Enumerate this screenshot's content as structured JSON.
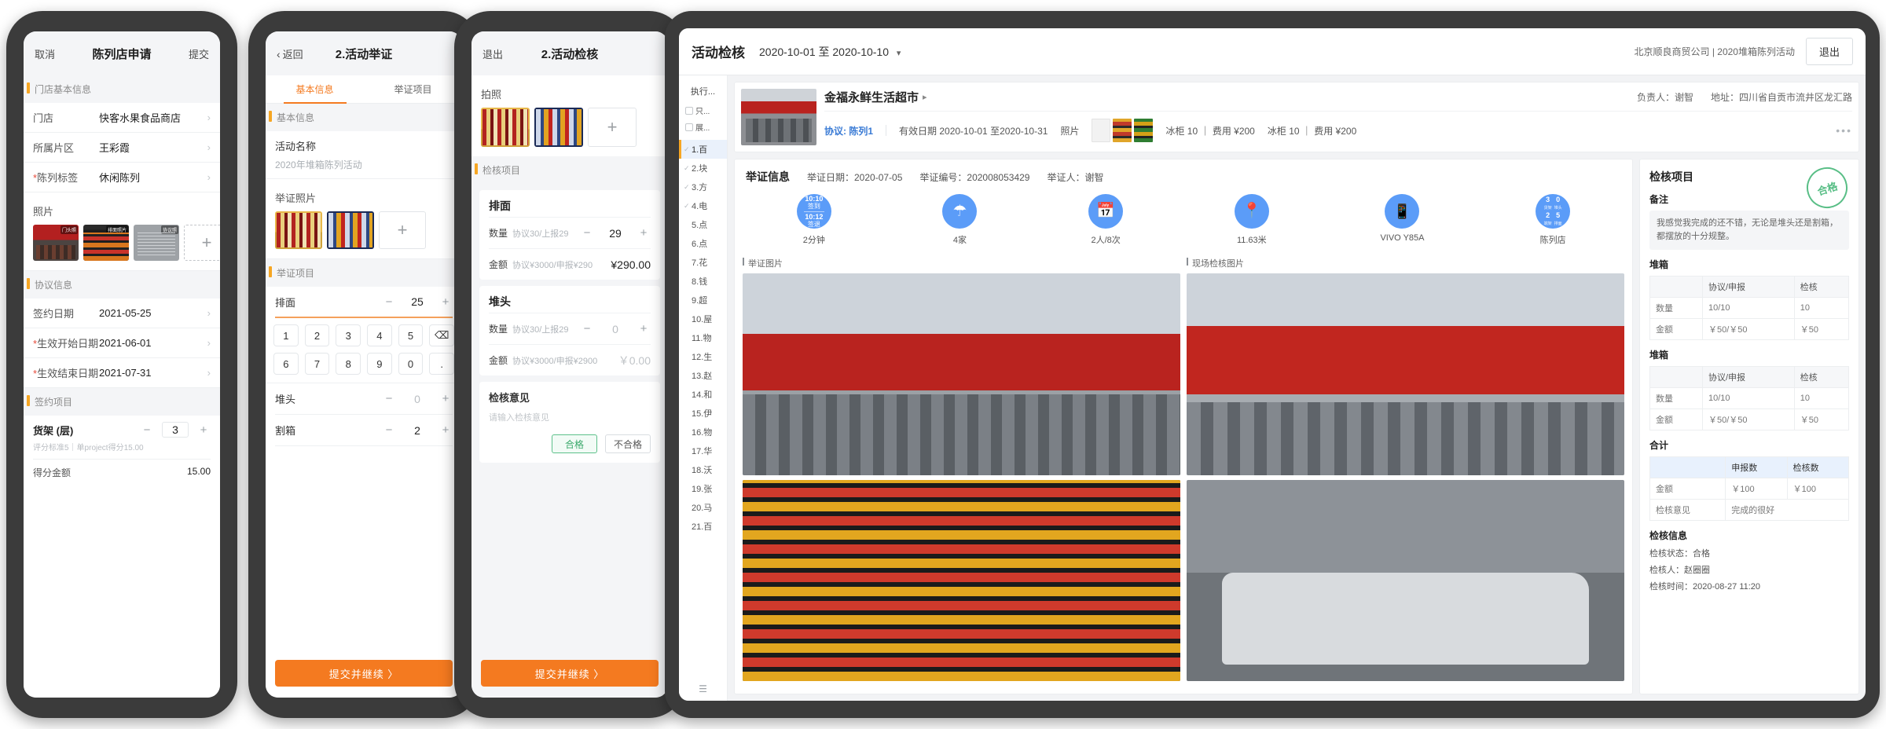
{
  "phone1": {
    "nav": {
      "left": "取消",
      "title": "陈列店申请",
      "right": "提交"
    },
    "sections": [
      {
        "title": "门店基本信息"
      }
    ],
    "store_rows": [
      {
        "label": "门店",
        "value": "快客水果食品商店",
        "required": false
      },
      {
        "label": "所属片区",
        "value": "王彩霞",
        "required": false
      },
      {
        "label": "陈列标签",
        "value": "休闲陈列",
        "required": true
      }
    ],
    "photos_label": "照片",
    "photo_captions": [
      "门头照",
      "排面照片",
      "协议照"
    ],
    "agreement_title": "协议信息",
    "agreement_rows": [
      {
        "label": "签约日期",
        "value": "2021-05-25",
        "required": false
      },
      {
        "label": "生效开始日期",
        "value": "2021-06-01",
        "required": true
      },
      {
        "label": "生效结束日期",
        "value": "2021-07-31",
        "required": true
      }
    ],
    "signed_title": "签约项目",
    "signed_item": {
      "name": "货架 (层)",
      "rule": "评分标准5｜单project得分15.00",
      "qty": "3",
      "amount_label": "得分金额",
      "amount_value": "15.00"
    }
  },
  "phone2": {
    "nav": {
      "left": "返回",
      "title": "2.活动举证"
    },
    "tabs": [
      {
        "label": "基本信息",
        "active": true
      },
      {
        "label": "举证项目",
        "active": false
      }
    ],
    "section_basic": "基本信息",
    "activity_label": "活动名称",
    "activity_value": "2020年堆箱陈列活动",
    "photos_label": "举证照片",
    "section_items": "举证项目",
    "item_rows": [
      {
        "name": "排面",
        "value": "25",
        "dim": false
      },
      {
        "name": "堆头",
        "value": "0",
        "dim": true
      },
      {
        "name": "割箱",
        "value": "2",
        "dim": false
      }
    ],
    "keypad": [
      [
        "1",
        "2",
        "3",
        "4",
        "5",
        "⌫"
      ],
      [
        "6",
        "7",
        "8",
        "9",
        "0",
        "."
      ]
    ],
    "submit": "提交并继续 〉"
  },
  "phone3": {
    "nav": {
      "left": "退出",
      "title": "2.活动检核"
    },
    "photo_label": "拍照",
    "section_items": "检核项目",
    "cards": [
      {
        "title": "排面",
        "qty_label": "数量",
        "qty_sub": "协议30/上报29",
        "qty_value": "29",
        "qty_dim": false,
        "amt_label": "金额",
        "amt_sub": "协议¥3000/申报¥290",
        "amt_value": "¥290.00",
        "amt_dim": false
      },
      {
        "title": "堆头",
        "qty_label": "数量",
        "qty_sub": "协议30/上报29",
        "qty_value": "0",
        "qty_dim": true,
        "amt_label": "金额",
        "amt_sub": "协议¥3000/申报¥2900",
        "amt_value": "￥0.00",
        "amt_dim": true
      }
    ],
    "opinion": {
      "title": "检核意见",
      "placeholder": "请输入检核意见",
      "pass": "合格",
      "fail": "不合格"
    },
    "submit": "提交并继续 〉"
  },
  "tablet": {
    "header": {
      "title": "活动检核",
      "date_range": "2020-10-01 至 2020-10-10",
      "company": "北京顺良商贸公司",
      "activity": "2020堆箱陈列活动",
      "logout": "退出"
    },
    "sidebar": {
      "filter_title": "执行...",
      "checks": [
        "只...",
        "展..."
      ],
      "items": [
        {
          "n": "1.百",
          "done": true,
          "active": true
        },
        {
          "n": "2.块",
          "done": true,
          "active": false
        },
        {
          "n": "3.方",
          "done": true,
          "active": false
        },
        {
          "n": "4.电",
          "done": true,
          "active": false
        },
        {
          "n": "5.点",
          "done": false,
          "active": false
        },
        {
          "n": "6.点",
          "done": false,
          "active": false
        },
        {
          "n": "7.花",
          "done": false,
          "active": false
        },
        {
          "n": "8.钱",
          "done": false,
          "active": false
        },
        {
          "n": "9.超",
          "done": false,
          "active": false
        },
        {
          "n": "10.屋",
          "done": false,
          "active": false
        },
        {
          "n": "11.物",
          "done": false,
          "active": false
        },
        {
          "n": "12.生",
          "done": false,
          "active": false
        },
        {
          "n": "13.赵",
          "done": false,
          "active": false
        },
        {
          "n": "14.和",
          "done": false,
          "active": false
        },
        {
          "n": "15.伊",
          "done": false,
          "active": false
        },
        {
          "n": "16.物",
          "done": false,
          "active": false
        },
        {
          "n": "17.华",
          "done": false,
          "active": false
        },
        {
          "n": "18.沃",
          "done": false,
          "active": false
        },
        {
          "n": "19.张",
          "done": false,
          "active": false
        },
        {
          "n": "20.马",
          "done": false,
          "active": false
        },
        {
          "n": "21.百",
          "done": false,
          "active": false
        }
      ]
    },
    "store": {
      "name": "金福永鲜生活超市",
      "owner": "负责人：谢智",
      "address": "地址：四川省自贡市流井区龙汇路",
      "agreement": "协议: 陈列1",
      "valid": "有效日期 2020-10-01 至2020-10-31",
      "photo_label": "照片",
      "stat1": "冰柜 10 ｜ 费用 ¥200",
      "stat2": "冰柜 10 ｜ 费用 ¥200"
    },
    "evidence": {
      "title": "举证信息",
      "date": "举证日期：2020-07-05",
      "number": "举证编号：202008053429",
      "person": "举证人：谢智",
      "stats": [
        {
          "icon": "clock-icon",
          "top": "10:10",
          "top_sub": "签到",
          "bottom": "10:12",
          "bottom_sub": "签退",
          "caption": "2分钟"
        },
        {
          "icon": "globe-icon",
          "caption": "4家"
        },
        {
          "icon": "calendar-icon",
          "caption": "2人/8次"
        },
        {
          "icon": "location-icon",
          "caption": "11.63米"
        },
        {
          "icon": "phone-icon",
          "caption": "VIVO Y85A"
        },
        {
          "icon": "grid-icon",
          "caption": "陈列店",
          "q": [
            {
              "v": "3",
              "l": "货架"
            },
            {
              "v": "0",
              "l": "堆头"
            },
            {
              "v": "2",
              "l": "端架"
            },
            {
              "v": "5",
              "l": "排面"
            }
          ]
        }
      ],
      "col_titles": [
        "举证图片",
        "现场检核图片"
      ]
    },
    "review": {
      "title": "检核项目",
      "stamp": "合格",
      "note_title": "备注",
      "note": "我感觉我完成的还不错，无论是堆头还是割箱，都摆放的十分规整。",
      "tables": [
        {
          "name": "堆箱",
          "headers": [
            "",
            "协议/申报",
            "检核"
          ],
          "rows": [
            [
              "数量",
              "10/10",
              "10"
            ],
            [
              "金额",
              "￥50/￥50",
              "￥50"
            ]
          ]
        },
        {
          "name": "堆箱",
          "headers": [
            "",
            "协议/申报",
            "检核"
          ],
          "rows": [
            [
              "数量",
              "10/10",
              "10"
            ],
            [
              "金额",
              "￥50/￥50",
              "￥50"
            ]
          ]
        }
      ],
      "total": {
        "name": "合计",
        "headers": [
          "",
          "申报数",
          "检核数"
        ],
        "rows": [
          [
            "金额",
            "￥100",
            "￥100"
          ],
          [
            "检核意见",
            "完成的很好",
            ""
          ]
        ]
      },
      "info_title": "检核信息",
      "info": [
        "检核状态：合格",
        "检核人：赵圈圈",
        "检核时间：2020-08-27 11:20"
      ]
    }
  }
}
